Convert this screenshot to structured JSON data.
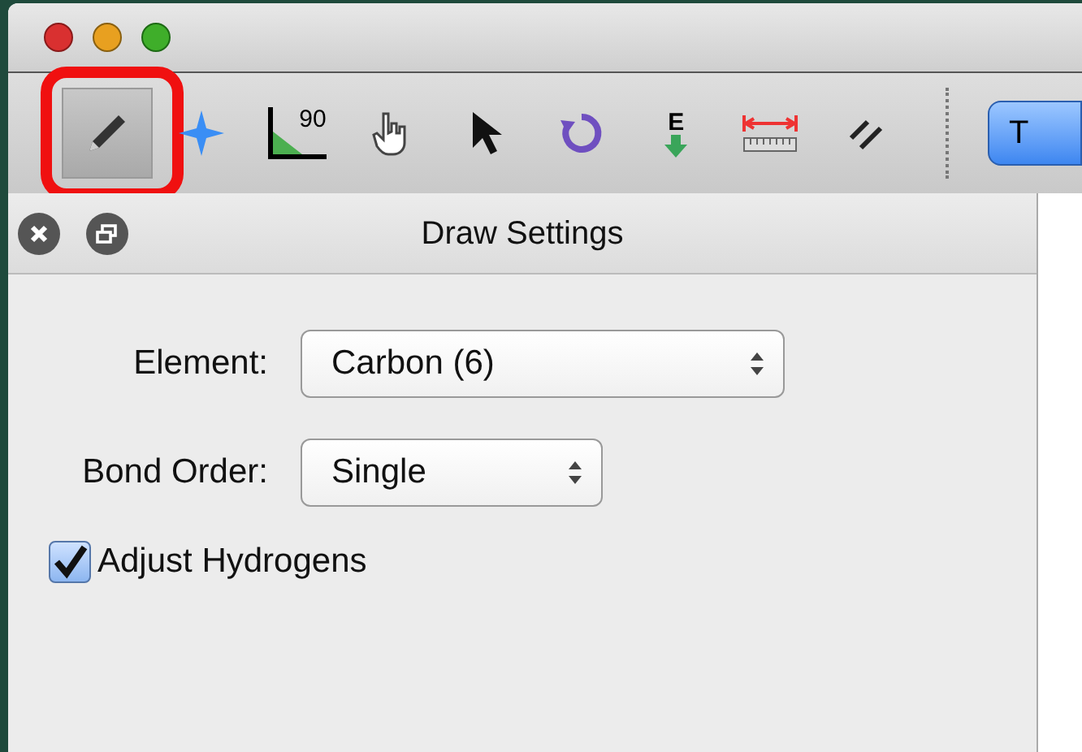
{
  "toolbar": {
    "tools": [
      {
        "kind": "draw",
        "selected": true,
        "highlighted": true
      },
      {
        "kind": "navigate",
        "selected": false,
        "highlighted": false
      },
      {
        "kind": "angle",
        "label": "90",
        "selected": false,
        "highlighted": false
      },
      {
        "kind": "manipulate",
        "selected": false,
        "highlighted": false
      },
      {
        "kind": "select",
        "selected": false,
        "highlighted": false
      },
      {
        "kind": "rotate",
        "selected": false,
        "highlighted": false
      },
      {
        "kind": "energy",
        "label": "E",
        "selected": false,
        "highlighted": false
      },
      {
        "kind": "measure",
        "selected": false,
        "highlighted": false
      },
      {
        "kind": "align",
        "selected": false,
        "highlighted": false
      }
    ],
    "button": {
      "label": "T"
    }
  },
  "panel": {
    "title": "Draw Settings",
    "fields": [
      {
        "label": "Element:",
        "value": "Carbon (6)"
      },
      {
        "label": "Bond Order:",
        "value": "Single"
      }
    ],
    "checkbox": {
      "label": "Adjust Hydrogens",
      "checked": true
    }
  }
}
